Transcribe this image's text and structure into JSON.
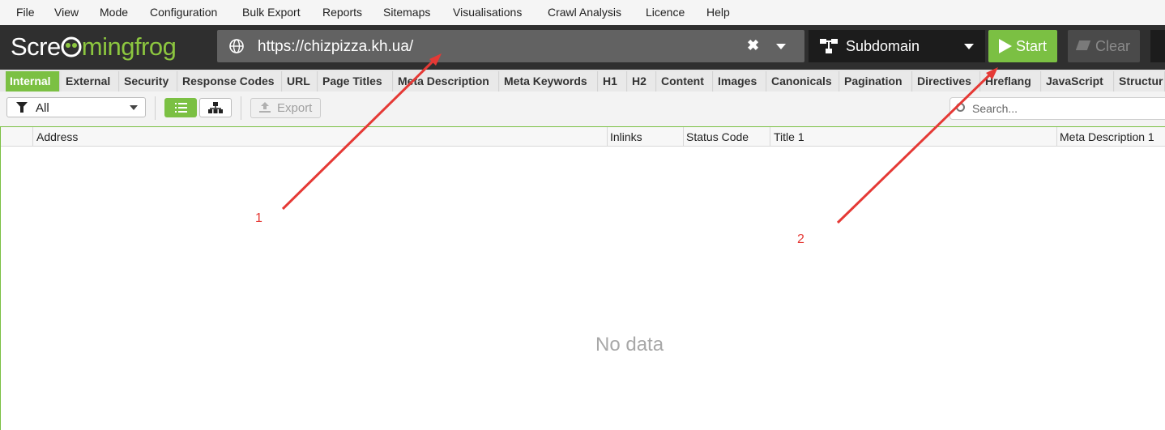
{
  "menu": [
    "File",
    "View",
    "Mode",
    "Configuration",
    "Bulk Export",
    "Reports",
    "Sitemaps",
    "Visualisations",
    "Crawl Analysis",
    "Licence",
    "Help"
  ],
  "logo": {
    "part1": "Scre",
    "part2": "mingfrog",
    "brand_color": "#8cc63f"
  },
  "url_bar": {
    "value": "https://chizpizza.kh.ua/"
  },
  "mode_selector": {
    "value": "Subdomain"
  },
  "buttons": {
    "start": "Start",
    "clear": "Clear",
    "export": "Export"
  },
  "tabs": [
    "Internal",
    "External",
    "Security",
    "Response Codes",
    "URL",
    "Page Titles",
    "Meta Description",
    "Meta Keywords",
    "H1",
    "H2",
    "Content",
    "Images",
    "Canonicals",
    "Pagination",
    "Directives",
    "Hreflang",
    "JavaScript",
    "Structur"
  ],
  "active_tab": "Internal",
  "filter": {
    "value": "All"
  },
  "search": {
    "placeholder": "Search..."
  },
  "table": {
    "columns": [
      "Address",
      "Inlinks",
      "Status Code",
      "Title 1",
      "Meta Description 1"
    ],
    "empty_text": "No data"
  },
  "annotations": [
    "1",
    "2"
  ],
  "colors": {
    "accent": "#7bc043",
    "arrow": "#e53935",
    "topbar": "#2f2f2f"
  }
}
